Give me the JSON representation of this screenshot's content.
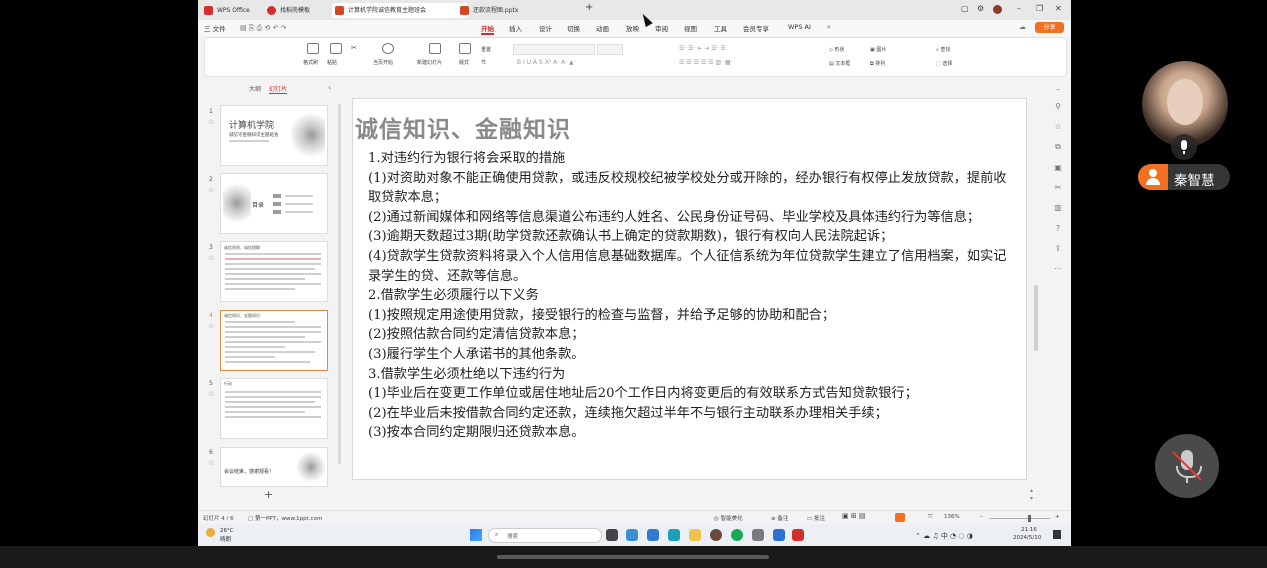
{
  "titlebar": {
    "tabs": [
      {
        "label": "WPS Office",
        "color": "#d32f2f"
      },
      {
        "label": "找稻壳模板",
        "color": "#d32f2f"
      },
      {
        "label": "计算机学院诚信教育主题班会",
        "color": "#d24726"
      },
      {
        "label": "还款流程图.pptx",
        "color": "#d24726"
      }
    ],
    "new_tab": "+"
  },
  "menubar": {
    "file": "三 文件",
    "items": [
      "开始",
      "插入",
      "设计",
      "切换",
      "动画",
      "放映",
      "审阅",
      "视图",
      "工具",
      "会员专享",
      "WPS AI"
    ],
    "share": "分享"
  },
  "ribbon": {
    "labels": [
      "格式刷",
      "粘贴",
      "当页开始",
      "新建幻灯片",
      "版式",
      "节",
      "重置",
      "形状",
      "图片",
      "文本框",
      "排列",
      "查找",
      "选择"
    ]
  },
  "leftpane": {
    "tab_outline": "大纲",
    "tab_slides": "幻灯片",
    "slides": [
      {
        "num": "1",
        "title": "计算机学院",
        "subtitle": "诚信守金融知识主题班会"
      },
      {
        "num": "2",
        "title": "目录"
      },
      {
        "num": "3",
        "title": "诚信原则、诚信理解"
      },
      {
        "num": "4",
        "title": "诚信知识、金融知识"
      },
      {
        "num": "5",
        "title": "行动"
      },
      {
        "num": "6",
        "title": "会议结束，感谢观看！"
      }
    ],
    "add": "+"
  },
  "slide": {
    "title": "诚信知识、金融知识",
    "lines": [
      "1.对违约行为银行将会采取的措施",
      "(1)对资助对象不能正确使用贷款，或违反校规校纪被学校处分或开除的，经办银行有权停止发放贷款，提前收取贷款本息；",
      "(2)通过新闻媒体和网络等信息渠道公布违约人姓名、公民身份证号码、毕业学校及具体违约行为等信息；",
      "(3)逾期天数超过3期(助学贷款还款确认书上确定的贷款期数)，银行有权向人民法院起诉；",
      "(4)贷款学生贷款资料将录入个人信用信息基础数据库。个人征信系统为年位贷款学生建立了信用档案，如实记录学生的贷、还款等信息。",
      "2.借款学生必须履行以下义务",
      "(1)按照规定用途使用贷款，接受银行的检查与监督，并给予足够的协助和配合；",
      "(2)按照估款合同约定清信贷款本息；",
      "(3)履行学生个人承诺书的其他条款。",
      "3.借款学生必须杜绝以下违约行为",
      "(1)毕业后在变更工作单位或居住地址后20个工作日内将变更后的有效联系方式告知贷款银行；",
      "(2)在毕业后未按借款合同约定还款，连续拖欠超过半年不与银行主动联系办理相关手续；",
      "(3)按本合同约定期限归还贷款本息。"
    ]
  },
  "statusbar": {
    "slide_counter": "幻灯片 4 / 6",
    "theme": "第一PPT，www.1ppt.com",
    "smart": "智能美化",
    "notes": "备注",
    "comment": "批注",
    "zoom": "136%"
  },
  "taskbar": {
    "weather_temp": "26°C",
    "weather_desc": "晴朗",
    "search_placeholder": "搜索",
    "lang": "中",
    "time": "21:16",
    "date": "2024/5/10"
  },
  "meeting": {
    "participant_name": "秦智慧",
    "accent": "#f37021"
  }
}
